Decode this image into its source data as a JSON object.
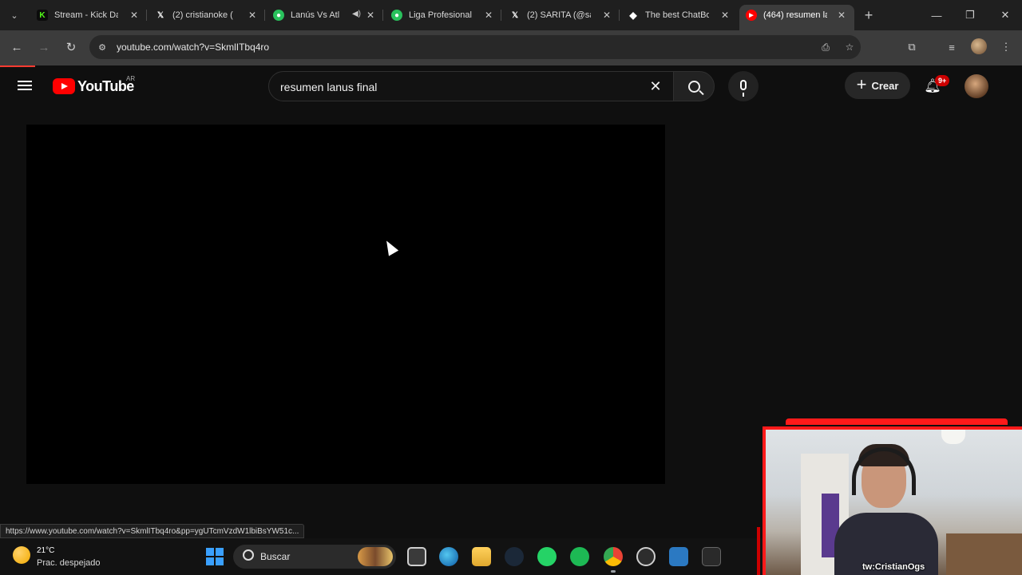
{
  "browser": {
    "tabs": [
      {
        "title": "Stream - Kick Da",
        "favicon": "kick-icon",
        "color": "#53fc18",
        "glyph": "K"
      },
      {
        "title": "(2) cristianoke (",
        "favicon": "x-icon",
        "color": "#ffffff",
        "glyph": "𝕏"
      },
      {
        "title": "Lanús Vs Atl",
        "favicon": "soccer-icon",
        "color": "#29c15c",
        "glyph": "⚽"
      },
      {
        "title": "Liga Profesional",
        "favicon": "soccer-icon",
        "color": "#29c15c",
        "glyph": "⚽"
      },
      {
        "title": "(2) SARITA (@sa",
        "favicon": "x-icon",
        "color": "#ffffff",
        "glyph": "𝕏"
      },
      {
        "title": "The best ChatBo",
        "favicon": "diamond-icon",
        "color": "#ffffff",
        "glyph": "◆"
      },
      {
        "title": "(464) resumen la",
        "favicon": "youtube-icon",
        "color": "#ff0000",
        "glyph": "▶",
        "active": true
      }
    ],
    "url": "youtube.com/watch?v=SkmlITbq4ro",
    "status_url": "https://www.youtube.com/watch?v=SkmlITbq4ro&pp=ygUTcmVzdW1lbiBsYW51c..."
  },
  "youtube": {
    "logo_text": "YouTube",
    "country": "AR",
    "search_query": "resumen lanus final",
    "create_label": "Crear",
    "notifications_badge": "9+",
    "accent": "#ff0000"
  },
  "taskbar": {
    "temperature": "21°C",
    "weather": "Prac. despejado",
    "search_label": "Buscar"
  },
  "webcam": {
    "label": "tw:CristianOgs"
  }
}
